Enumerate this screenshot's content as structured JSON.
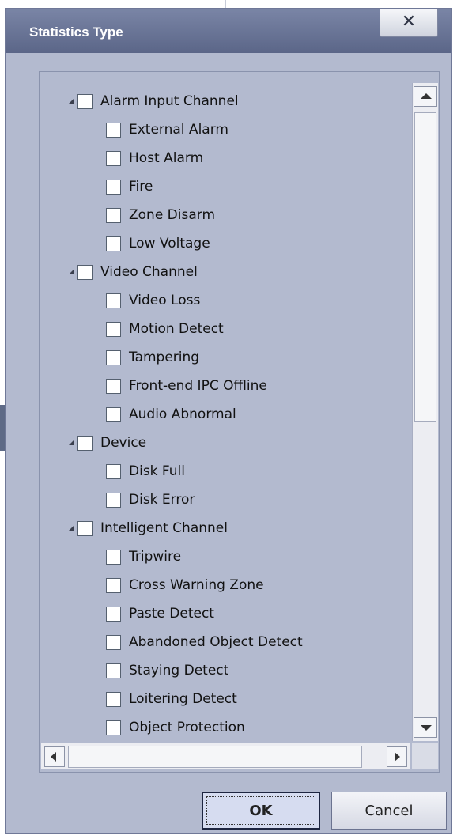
{
  "dialog": {
    "title": "Statistics Type",
    "close_glyph": "✕",
    "ok_label": "OK",
    "cancel_label": "Cancel"
  },
  "tree": {
    "groups": [
      {
        "label": "Alarm Input Channel",
        "expanded": true,
        "checked": false,
        "items": [
          "External Alarm",
          "Host Alarm",
          "Fire",
          "Zone Disarm",
          "Low Voltage"
        ]
      },
      {
        "label": "Video Channel",
        "expanded": true,
        "checked": false,
        "items": [
          "Video Loss",
          "Motion Detect",
          "Tampering",
          "Front-end IPC Offline",
          "Audio Abnormal"
        ]
      },
      {
        "label": "Device",
        "expanded": true,
        "checked": false,
        "items": [
          "Disk Full",
          "Disk Error"
        ]
      },
      {
        "label": "Intelligent Channel",
        "expanded": true,
        "checked": false,
        "items": [
          "Tripwire",
          "Cross Warning Zone",
          "Paste Detect",
          "Abandoned Object Detect",
          "Staying Detect",
          "Loitering Detect",
          "Object Protection"
        ]
      }
    ]
  },
  "icons": {
    "expander": "expanded-arrow-icon",
    "close": "close-icon",
    "scroll_up": "arrow-up-icon",
    "scroll_down": "arrow-down-icon",
    "scroll_left": "arrow-left-icon",
    "scroll_right": "arrow-right-icon"
  },
  "colors": {
    "titlebar": "#6b7597",
    "dialog_bg": "#b3bacf",
    "ok_bg": "#d6dcf0"
  }
}
